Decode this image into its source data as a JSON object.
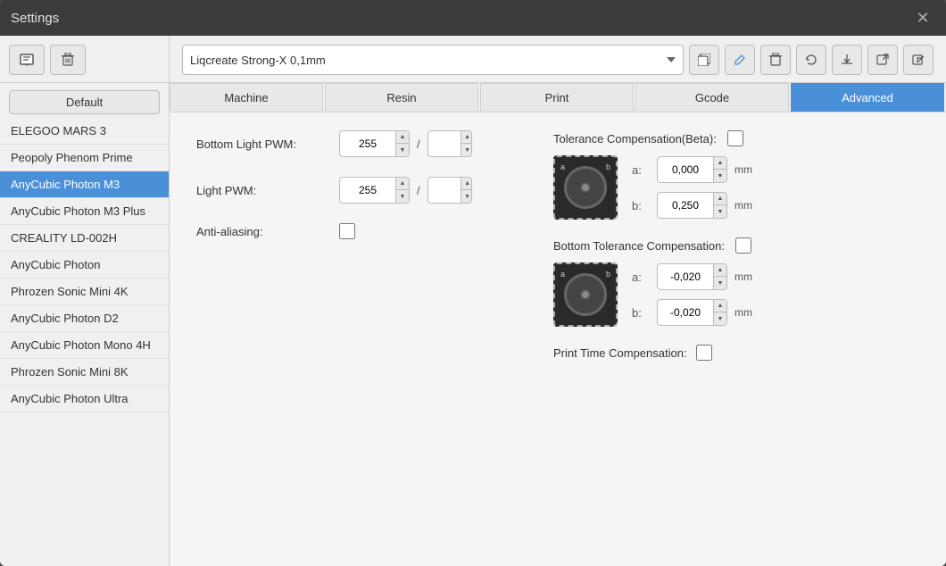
{
  "window": {
    "title": "Settings"
  },
  "sidebar": {
    "toolbar": {
      "add_icon": "📄",
      "delete_icon": "🗑"
    },
    "default_btn": "Default",
    "items": [
      {
        "id": "elegoo-mars-3",
        "label": "ELEGOO MARS 3",
        "active": false
      },
      {
        "id": "peopoly-phenom-prime",
        "label": "Peopoly Phenom Prime",
        "active": false
      },
      {
        "id": "anycubic-photon-m3",
        "label": "AnyCubic Photon M3",
        "active": true
      },
      {
        "id": "anycubic-photon-m3-plus",
        "label": "AnyCubic Photon M3 Plus",
        "active": false
      },
      {
        "id": "creality-ld-002h",
        "label": "CREALITY LD-002H",
        "active": false
      },
      {
        "id": "anycubic-photon",
        "label": "AnyCubic Photon",
        "active": false
      },
      {
        "id": "phrozen-sonic-mini-4k",
        "label": "Phrozen Sonic Mini 4K",
        "active": false
      },
      {
        "id": "anycubic-photon-d2",
        "label": "AnyCubic Photon D2",
        "active": false
      },
      {
        "id": "anycubic-photon-mono-4h",
        "label": "AnyCubic Photon Mono 4H",
        "active": false
      },
      {
        "id": "phrozen-sonic-mini-8k",
        "label": "Phrozen Sonic Mini 8K",
        "active": false
      },
      {
        "id": "anycubic-photon-ultra",
        "label": "AnyCubic Photon Ultra",
        "active": false
      }
    ]
  },
  "profile": {
    "current": "Liqcreate Strong-X 0,1mm",
    "options": [
      "Liqcreate Strong-X 0,1mm"
    ]
  },
  "tabs": [
    {
      "id": "machine",
      "label": "Machine",
      "active": false
    },
    {
      "id": "resin",
      "label": "Resin",
      "active": false
    },
    {
      "id": "print",
      "label": "Print",
      "active": false
    },
    {
      "id": "gcode",
      "label": "Gcode",
      "active": false
    },
    {
      "id": "advanced",
      "label": "Advanced",
      "active": true
    }
  ],
  "advanced": {
    "bottom_light_pwm": {
      "label": "Bottom Light PWM:",
      "value": "255",
      "slash": "/",
      "slash_value": ""
    },
    "light_pwm": {
      "label": "Light PWM:",
      "value": "255",
      "slash": "/",
      "slash_value": ""
    },
    "anti_aliasing": {
      "label": "Anti-aliasing:",
      "checked": false
    },
    "tolerance_compensation": {
      "title": "Tolerance Compensation(Beta):",
      "checked": false,
      "a_label": "a:",
      "a_value": "0,000",
      "a_unit": "mm",
      "b_label": "b:",
      "b_value": "0,250",
      "b_unit": "mm"
    },
    "bottom_tolerance_compensation": {
      "title": "Bottom Tolerance Compensation:",
      "checked": false,
      "a_label": "a:",
      "a_value": "-0,020",
      "a_unit": "mm",
      "b_label": "b:",
      "b_value": "-0,020",
      "b_unit": "mm"
    },
    "print_time_compensation": {
      "label": "Print Time Compensation:",
      "checked": false
    }
  },
  "colors": {
    "accent": "#4a90d9",
    "active_tab_bg": "#4a90d9",
    "active_sidebar_bg": "#4a90d9"
  }
}
